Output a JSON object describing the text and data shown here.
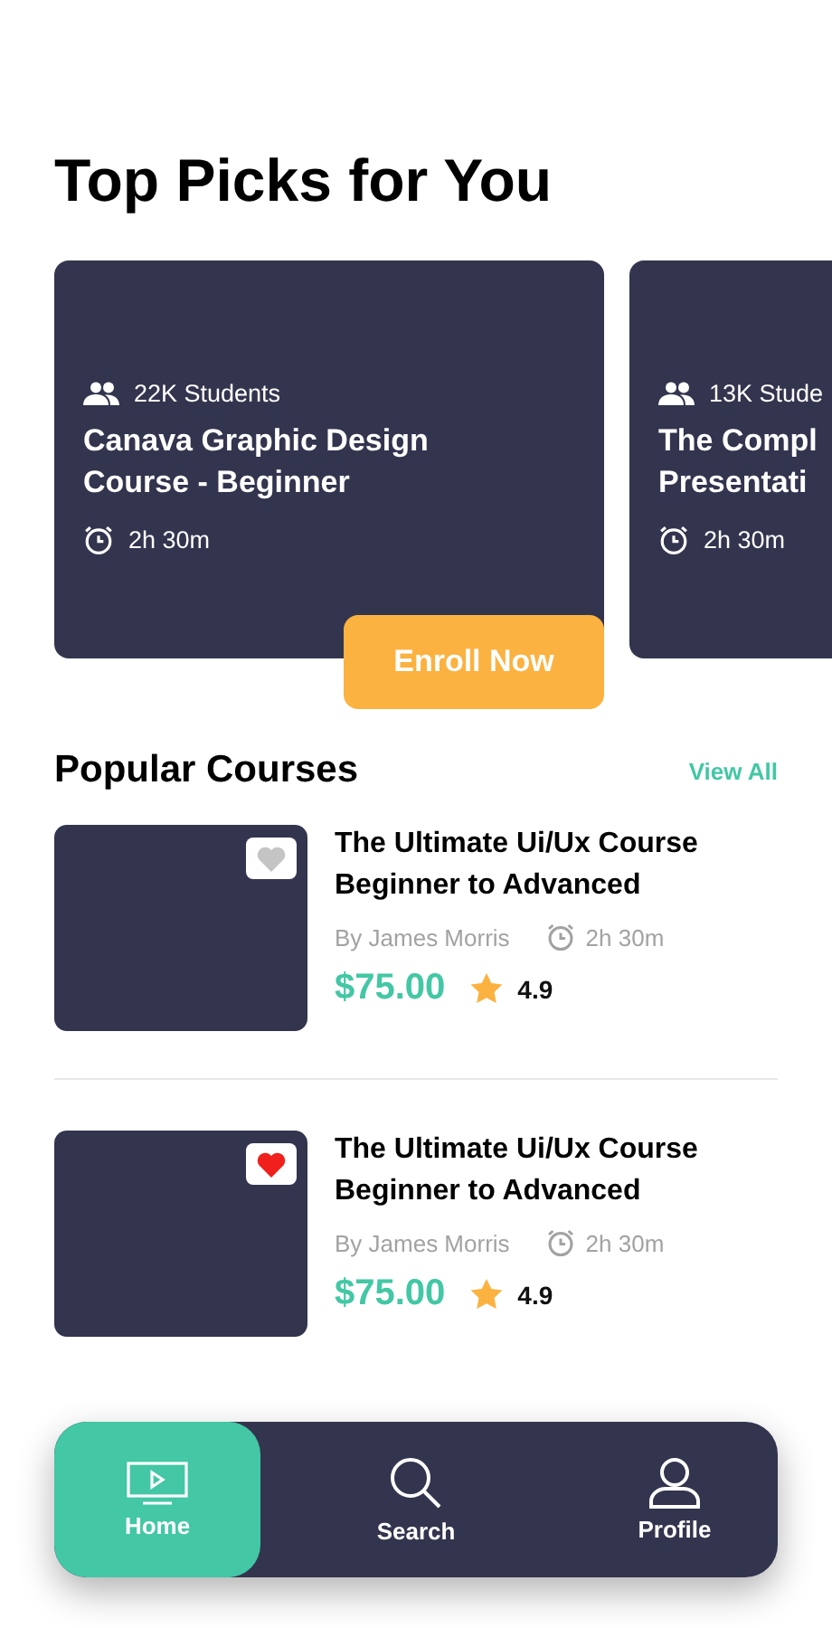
{
  "heading": "Top Picks for You",
  "picks": [
    {
      "students": "22K Students",
      "title": "Canava Graphic Design Course - Beginner",
      "duration": "2h 30m",
      "action": "Enroll Now"
    },
    {
      "students": "13K Stude",
      "title": "The Compl Presentati",
      "duration": "2h 30m"
    }
  ],
  "popular": {
    "title": "Popular Courses",
    "link": "View All",
    "courses": [
      {
        "title": "The Ultimate Ui/Ux Course Beginner to Advanced",
        "author": "By James Morris",
        "duration": "2h 30m",
        "price": "$75.00",
        "rating": "4.9",
        "favorite": false
      },
      {
        "title": "The Ultimate Ui/Ux Course Beginner to Advanced",
        "author": "By James Morris",
        "duration": "2h 30m",
        "price": "$75.00",
        "rating": "4.9",
        "favorite": true
      }
    ]
  },
  "nav": [
    {
      "kind": "home",
      "label": "Home",
      "selected": true
    },
    {
      "kind": "search",
      "label": "Search",
      "selected": false
    },
    {
      "kind": "profile",
      "label": "Profile",
      "selected": false
    }
  ]
}
